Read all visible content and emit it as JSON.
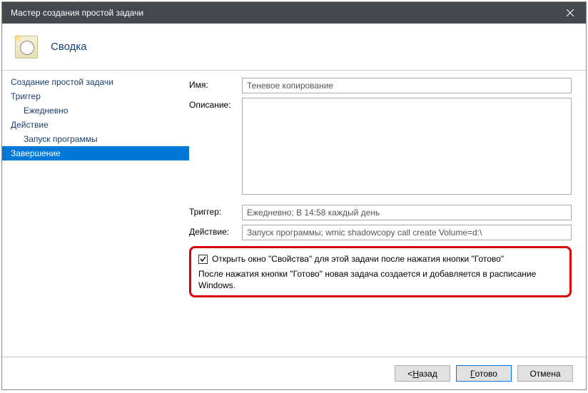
{
  "window": {
    "title": "Мастер создания простой задачи"
  },
  "header": {
    "title": "Сводка"
  },
  "sidebar": {
    "items": [
      {
        "label": "Создание простой задачи",
        "sub": false
      },
      {
        "label": "Триггер",
        "sub": false
      },
      {
        "label": "Ежедневно",
        "sub": true
      },
      {
        "label": "Действие",
        "sub": false
      },
      {
        "label": "Запуск программы",
        "sub": true
      },
      {
        "label": "Завершение",
        "sub": false,
        "selected": true
      }
    ]
  },
  "form": {
    "name_label": "Имя:",
    "name_value": "Теневое копирование",
    "desc_label": "Описание:",
    "desc_value": "",
    "trigger_label": "Триггер:",
    "trigger_value": "Ежедневно; В 14:58 каждый день",
    "action_label": "Действие:",
    "action_value": "Запуск программы; wmic shadowcopy call create Volume=d:\\"
  },
  "highlight": {
    "checkbox_label": "Открыть окно \"Свойства\" для этой задачи после нажатия кнопки \"Готово\"",
    "checkbox_checked": true,
    "info": "После нажатия кнопки \"Готово\" новая задача создается и добавляется в расписание Windows."
  },
  "buttons": {
    "back_prefix": "< ",
    "back_mn": "Н",
    "back_rest": "азад",
    "finish_mn": "Г",
    "finish_rest": "отово",
    "cancel": "Отмена"
  }
}
